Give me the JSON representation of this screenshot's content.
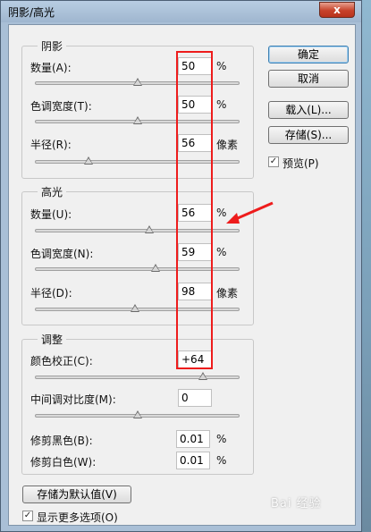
{
  "window": {
    "title": "阴影/高光",
    "close_glyph": "x"
  },
  "shadows": {
    "legend": "阴影",
    "amount": {
      "label": "数量(A):",
      "value": "50",
      "unit": "%",
      "slider_fraction": 0.5
    },
    "tonal_width": {
      "label": "色调宽度(T):",
      "value": "50",
      "unit": "%",
      "slider_fraction": 0.5
    },
    "radius": {
      "label": "半径(R):",
      "value": "56",
      "unit": "像素",
      "slider_fraction": 0.26
    }
  },
  "highlights": {
    "legend": "高光",
    "amount": {
      "label": "数量(U):",
      "value": "56",
      "unit": "%",
      "slider_fraction": 0.56
    },
    "tonal_width": {
      "label": "色调宽度(N):",
      "value": "59",
      "unit": "%",
      "slider_fraction": 0.59
    },
    "radius": {
      "label": "半径(D):",
      "value": "98",
      "unit": "像素",
      "slider_fraction": 0.49
    }
  },
  "adjustments": {
    "legend": "调整",
    "color_correction": {
      "label": "颜色校正(C):",
      "value": "+64",
      "slider_fraction": 0.82
    },
    "midtone_contrast": {
      "label": "中间调对比度(M):",
      "value": "0",
      "slider_fraction": 0.5
    },
    "black_clip": {
      "label": "修剪黑色(B):",
      "value": "0.01",
      "unit": "%"
    },
    "white_clip": {
      "label": "修剪白色(W):",
      "value": "0.01",
      "unit": "%"
    }
  },
  "buttons": {
    "ok": "确定",
    "cancel": "取消",
    "load": "载入(L)...",
    "save": "存储(S)...",
    "save_default": "存储为默认值(V)"
  },
  "checkboxes": {
    "preview": {
      "label": "预览(P)",
      "checked": true
    },
    "show_more": {
      "label": "显示更多选项(O)",
      "checked": true
    }
  },
  "watermark": "Bai 经验",
  "colors": {
    "annotation_red": "#ee1c1c",
    "titlebar": "#a9bfd6",
    "close_button": "#c7422a"
  },
  "icons": {
    "check": "✓"
  }
}
